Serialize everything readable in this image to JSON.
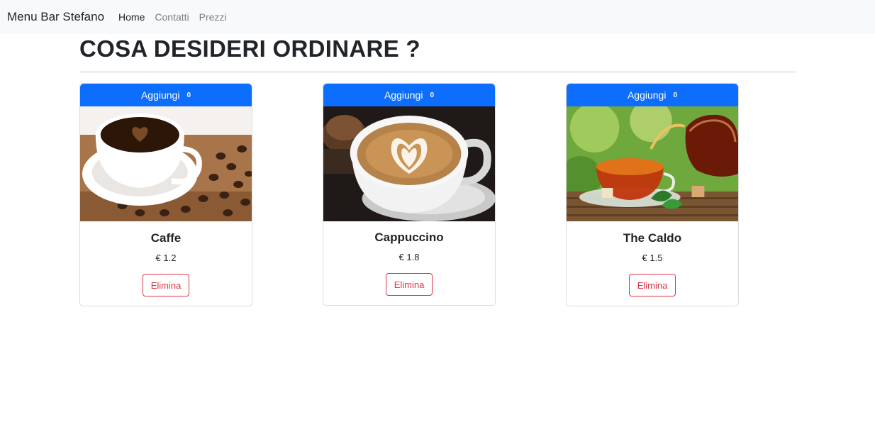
{
  "navbar": {
    "brand": "Menu Bar Stefano",
    "links": [
      {
        "label": "Home",
        "active": true
      },
      {
        "label": "Contatti",
        "active": false
      },
      {
        "label": "Prezzi",
        "active": false
      }
    ]
  },
  "page": {
    "title": "COSA DESIDERI ORDINARE ?"
  },
  "products": [
    {
      "name": "Caffe",
      "price": "€ 1.2",
      "add_label": "Aggiungi",
      "count": "0",
      "delete_label": "Elimina",
      "image": "coffee-cup-photo"
    },
    {
      "name": "Cappuccino",
      "price": "€ 1.8",
      "add_label": "Aggiungi",
      "count": "0",
      "delete_label": "Elimina",
      "image": "cappuccino-photo"
    },
    {
      "name": "The Caldo",
      "price": "€ 1.5",
      "add_label": "Aggiungi",
      "count": "0",
      "delete_label": "Elimina",
      "image": "hot-tea-photo"
    }
  ],
  "colors": {
    "primary": "#0d6efd",
    "danger": "#dc3545",
    "navbar_bg": "#f8f9fa"
  }
}
